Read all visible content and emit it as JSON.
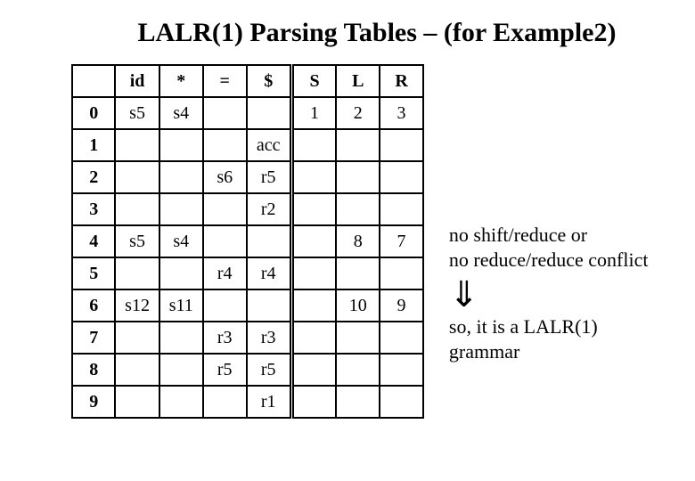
{
  "title": "LALR(1) Parsing Tables – (for Example2)",
  "headers": {
    "id": "id",
    "star": "*",
    "eq": "=",
    "dol": "$",
    "S": "S",
    "L": "L",
    "R": "R"
  },
  "states": [
    "0",
    "1",
    "2",
    "3",
    "4",
    "5",
    "6",
    "7",
    "8",
    "9"
  ],
  "chart_data": {
    "type": "table",
    "title": "LALR(1) Parsing Tables – (for Example2)",
    "columns": [
      "state",
      "id",
      "*",
      "=",
      "$",
      "S",
      "L",
      "R"
    ],
    "rows": [
      {
        "state": "0",
        "id": "s5",
        "*": "s4",
        "=": "",
        "$": "",
        "S": "1",
        "L": "2",
        "R": "3"
      },
      {
        "state": "1",
        "id": "",
        "*": "",
        "=": "",
        "$": "acc",
        "S": "",
        "L": "",
        "R": ""
      },
      {
        "state": "2",
        "id": "",
        "*": "",
        "=": "s6",
        "$": "r5",
        "S": "",
        "L": "",
        "R": ""
      },
      {
        "state": "3",
        "id": "",
        "*": "",
        "=": "",
        "$": "r2",
        "S": "",
        "L": "",
        "R": ""
      },
      {
        "state": "4",
        "id": "s5",
        "*": "s4",
        "=": "",
        "$": "",
        "S": "",
        "L": "8",
        "R": "7"
      },
      {
        "state": "5",
        "id": "",
        "*": "",
        "=": "r4",
        "$": "r4",
        "S": "",
        "L": "",
        "R": ""
      },
      {
        "state": "6",
        "id": "s12",
        "*": "s11",
        "=": "",
        "$": "",
        "S": "",
        "L": "10",
        "R": "9"
      },
      {
        "state": "7",
        "id": "",
        "*": "",
        "=": "r3",
        "$": "r3",
        "S": "",
        "L": "",
        "R": ""
      },
      {
        "state": "8",
        "id": "",
        "*": "",
        "=": "r5",
        "$": "r5",
        "S": "",
        "L": "",
        "R": ""
      },
      {
        "state": "9",
        "id": "",
        "*": "",
        "=": "",
        "$": "r1",
        "S": "",
        "L": "",
        "R": ""
      }
    ]
  },
  "notes": {
    "line1": "no shift/reduce or",
    "line2": "no reduce/reduce conflict",
    "arrow": "⇓",
    "line3": "so, it is a LALR(1) grammar"
  }
}
